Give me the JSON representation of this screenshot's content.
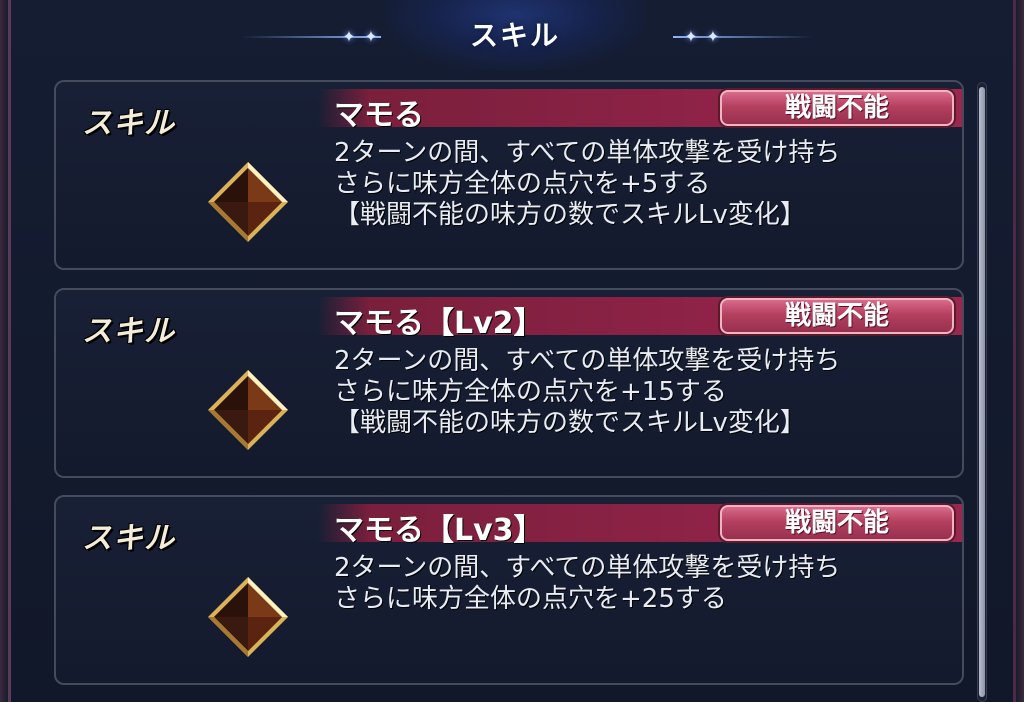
{
  "header": {
    "title": "スキル"
  },
  "skills": [
    {
      "label": "スキル",
      "name": "マモる",
      "badge": "戦闘不能",
      "desc": [
        "2ターンの間、すべての単体攻撃を受け持ち",
        "さらに味方全体の点穴を+5する",
        "【戦闘不能の味方の数でスキルLv変化】"
      ],
      "icon": "diamond-gem-icon"
    },
    {
      "label": "スキル",
      "name": "マモる【Lv2】",
      "badge": "戦闘不能",
      "desc": [
        "2ターンの間、すべての単体攻撃を受け持ち",
        "さらに味方全体の点穴を+15する",
        "【戦闘不能の味方の数でスキルLv変化】"
      ],
      "icon": "diamond-gem-icon"
    },
    {
      "label": "スキル",
      "name": "マモる【Lv3】",
      "badge": "戦闘不能",
      "desc": [
        "2ターンの間、すべての単体攻撃を受け持ち",
        "さらに味方全体の点穴を+25する"
      ],
      "icon": "diamond-gem-icon"
    }
  ],
  "colors": {
    "name_bar": "#8e2347",
    "badge": "#b4405f",
    "panel": "#141a2d",
    "accent_line": "#8fb4ff"
  }
}
